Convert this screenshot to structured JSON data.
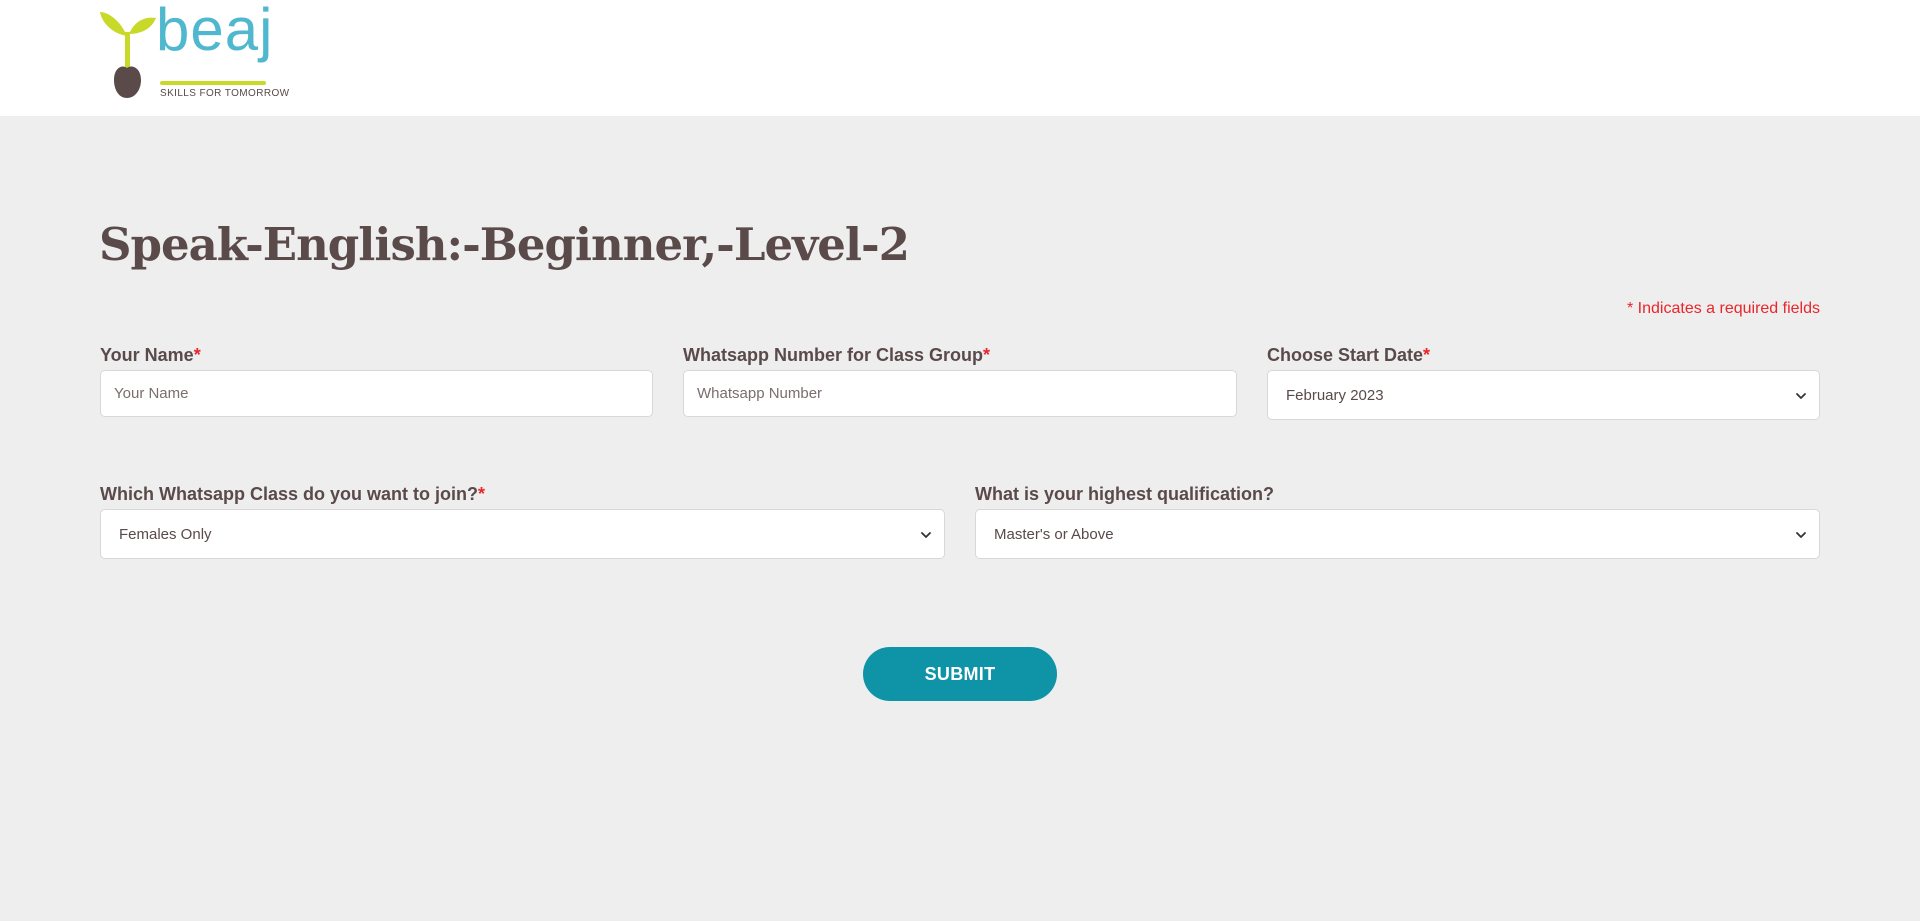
{
  "brand": {
    "name": "beaj",
    "tagline": "SKILLS FOR TOMORROW",
    "colors": {
      "leaf": "#c8d92a",
      "seed": "#5a4a4a",
      "wordmark": "#4fb8cf"
    }
  },
  "form": {
    "title": "Speak-English:-Beginner,-Level-2",
    "required_note": "* Indicates a required fields",
    "required_marker": "*",
    "fields": {
      "name": {
        "label": "Your Name",
        "placeholder": "Your Name",
        "value": "",
        "required": true
      },
      "whatsapp": {
        "label": "Whatsapp Number for Class Group",
        "placeholder": "Whatsapp Number",
        "value": "",
        "required": true
      },
      "start_date": {
        "label": "Choose Start Date",
        "selected": "February 2023",
        "required": true
      },
      "class_type": {
        "label": "Which Whatsapp Class do you want to join?",
        "selected": "Females Only",
        "required": true
      },
      "qualification": {
        "label": "What is your highest qualification?",
        "selected": "Master's or Above",
        "required": false
      }
    },
    "submit_label": "SUBMIT"
  },
  "colors": {
    "page_background": "#eeeeee",
    "header_background": "#ffffff",
    "text": "#5a4a4a",
    "required": "#e8262b",
    "accent": "#0f93a7"
  },
  "icons": {
    "select_arrow": "chevron-down-icon",
    "logo_mark": "sprout-icon"
  }
}
